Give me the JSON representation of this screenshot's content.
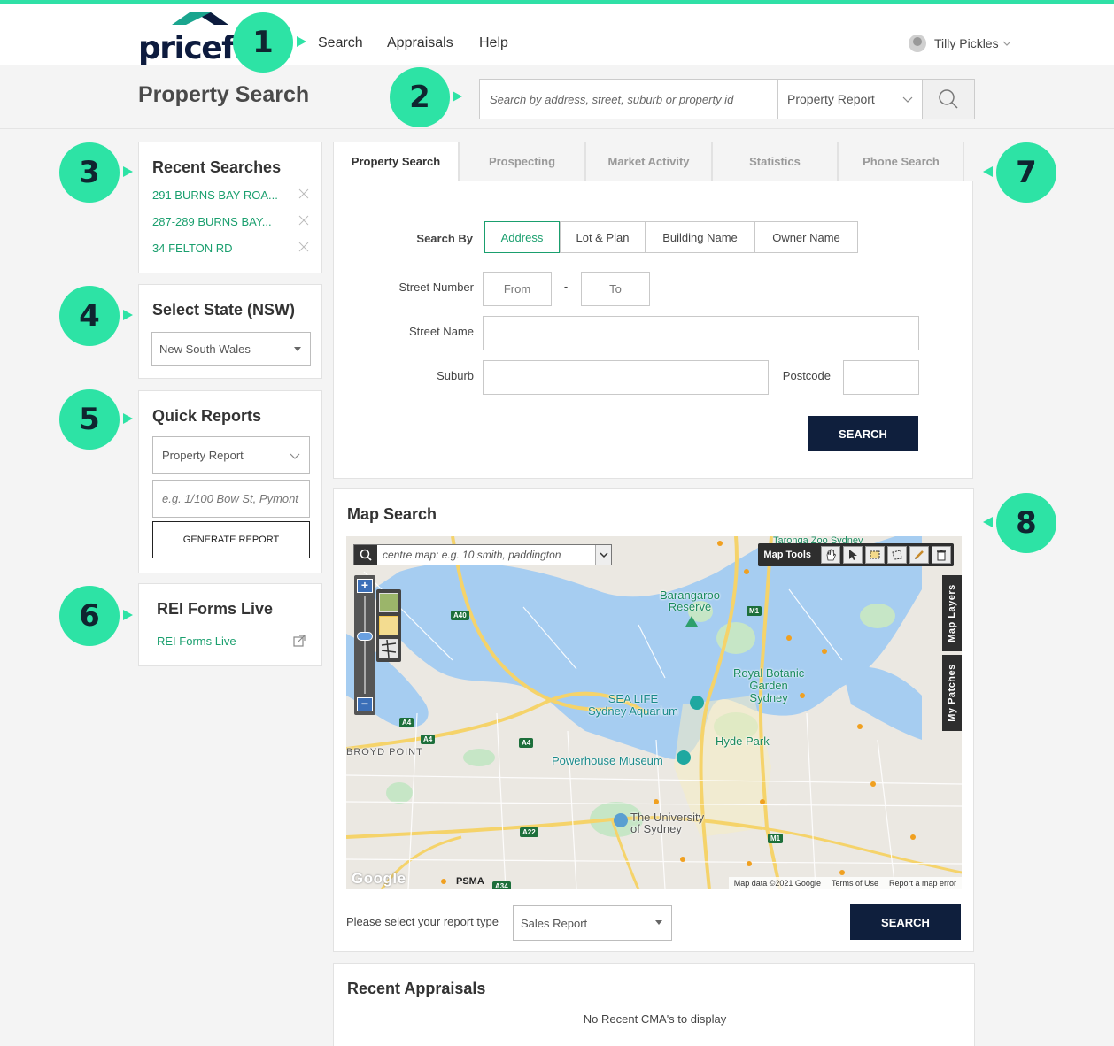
{
  "header": {
    "logo_text": "pricefinder",
    "nav": [
      "Search",
      "Appraisals",
      "Help"
    ],
    "user_name": "Tilly Pickles"
  },
  "subheader": {
    "title": "Property Search",
    "search_placeholder": "Search by address, street, suburb or property id",
    "report_select": "Property Report"
  },
  "badges": [
    "1",
    "2",
    "3",
    "4",
    "5",
    "6",
    "7",
    "8"
  ],
  "recent_searches": {
    "title": "Recent Searches",
    "items": [
      "291 BURNS BAY ROA...",
      "287-289 BURNS BAY...",
      "34 FELTON RD"
    ]
  },
  "select_state": {
    "title": "Select State (NSW)",
    "value": "New South Wales"
  },
  "quick_reports": {
    "title": "Quick Reports",
    "report_type": "Property Report",
    "address_placeholder": "e.g. 1/100 Bow St, Pymont",
    "button": "GENERATE REPORT"
  },
  "rei_forms": {
    "title": "REI Forms Live",
    "link": "REI Forms Live"
  },
  "tabs": [
    "Property Search",
    "Prospecting",
    "Market Activity",
    "Statistics",
    "Phone Search"
  ],
  "search_form": {
    "search_by_label": "Search By",
    "search_by_options": [
      "Address",
      "Lot & Plan",
      "Building Name",
      "Owner Name"
    ],
    "street_number_label": "Street Number",
    "from_placeholder": "From",
    "dash": "-",
    "to_placeholder": "To",
    "street_name_label": "Street Name",
    "suburb_label": "Suburb",
    "postcode_label": "Postcode",
    "search_button": "SEARCH"
  },
  "map_search": {
    "title": "Map Search",
    "centre_placeholder": "centre map: e.g. 10 smith, paddington",
    "map_tools_label": "Map Tools",
    "map_layers_tab": "Map Layers",
    "my_patches_tab": "My Patches",
    "labels": {
      "barangaroo": "Barangaroo\nReserve",
      "royal_botanic": "Royal Botanic\nGarden\nSydney",
      "sea_life": "SEA LIFE\nSydney Aquarium",
      "hyde_park": "Hyde Park",
      "powerhouse": "Powerhouse Museum",
      "university": "The University\nof Sydney",
      "broyd_point": "BROYD POINT",
      "taronga": "Taronga Zoo Sydney"
    },
    "road_badges": [
      "A40",
      "M1",
      "A4",
      "A4",
      "A4",
      "A22",
      "M1",
      "A34"
    ],
    "google": "Google",
    "psma": "PSMA",
    "attribution": [
      "Map data ©2021 Google",
      "Terms of Use",
      "Report a map error"
    ],
    "report_type_label": "Please select your report type",
    "report_type_value": "Sales Report",
    "search_button": "SEARCH"
  },
  "recent_appraisals": {
    "title": "Recent Appraisals",
    "empty": "No Recent CMA's to display"
  },
  "colors": {
    "accent_green": "#2de3a5",
    "link_green": "#1a9f6e",
    "navy": "#0f1f3d"
  }
}
